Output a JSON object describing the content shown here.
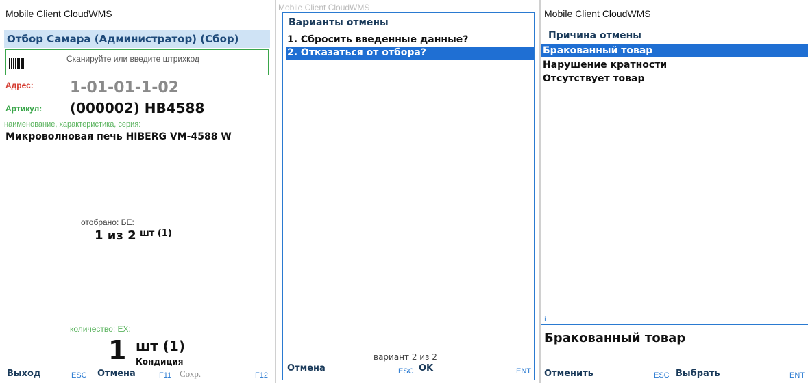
{
  "app_title": "Mobile Client CloudWMS",
  "screen1": {
    "header": "Отбор Самара (Администратор) (Сбор)",
    "scan_placeholder": "Сканируйте или введите штрихкод",
    "address_label": "Адрес:",
    "address_value": "1-01-01-1-02",
    "article_label": "Артикул:",
    "article_value": "(000002) HB4588",
    "name_hint": "наименование,  характеристика,  серия:",
    "product_name": "Микроволновая печь HIBERG VM-4588 W",
    "picked_label": "отобрано: БЕ:",
    "picked_value": "1 из 2",
    "picked_unit": "шт (1)",
    "qty_label": "количество: ЕХ:",
    "qty_value": "1",
    "qty_unit": "шт (1)",
    "condition": "Кондиция",
    "footer": {
      "exit": "Выход",
      "exit_key": "ESC",
      "cancel": "Отмена",
      "cancel_key": "F11",
      "save": "Сохр.",
      "save_key": "F12"
    }
  },
  "screen2": {
    "ghost_title": "Mobile Client CloudWMS",
    "dialog_title": "Варианты отмены",
    "options": [
      "1. Сбросить введенные данные?",
      "2. Отказаться от отбора?"
    ],
    "selected_index": 1,
    "counter": "вариант  2 из 2",
    "footer": {
      "cancel": "Отмена",
      "cancel_key": "ESC",
      "ok": "OK",
      "ok_key": "ENT"
    }
  },
  "screen3": {
    "subtitle": "Причина отмены",
    "reasons": [
      "Бракованный товар",
      "Нарушение кратности",
      "Отсутствует товар"
    ],
    "selected_index": 0,
    "info_marker": "i",
    "info_text": "Бракованный товар",
    "footer": {
      "cancel": "Отменить",
      "cancel_key": "ESC",
      "select": "Выбрать",
      "select_key": "ENT"
    }
  },
  "colors": {
    "selection": "#1f6fd3",
    "header_bg": "#cfe3f5",
    "label_red": "#d43a2f",
    "label_green": "#3aa64a",
    "key_blue": "#2a7ad1"
  }
}
